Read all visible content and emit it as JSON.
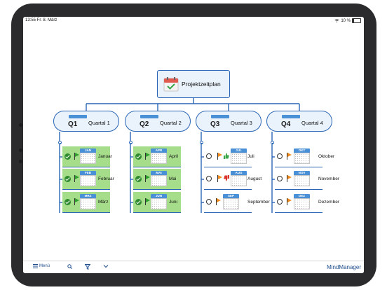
{
  "status_bar": {
    "time_date": "13:55  Fr. 8. März",
    "battery": "10 %"
  },
  "central_topic": {
    "label": "Projektzeitplan",
    "icon": "calendar-check-icon"
  },
  "colors": {
    "line": "#2a66b5",
    "accent": "#4a90d6",
    "done_fill": "#a6dd8b",
    "flag_green": "#2e9e2e",
    "flag_orange": "#f08a1c"
  },
  "quarters": [
    {
      "num": "Q1",
      "label": "Quartal 1",
      "months": [
        {
          "tab": "JAN",
          "name": "Januar",
          "status": "done",
          "flag": "green"
        },
        {
          "tab": "FEB",
          "name": "Februar",
          "status": "done",
          "flag": "green"
        },
        {
          "tab": "MRZ",
          "name": "März",
          "status": "done",
          "flag": "green"
        }
      ]
    },
    {
      "num": "Q2",
      "label": "Quartal 2",
      "months": [
        {
          "tab": "APR",
          "name": "April",
          "status": "done",
          "flag": "green"
        },
        {
          "tab": "MAI",
          "name": "Mai",
          "status": "done",
          "flag": "green"
        },
        {
          "tab": "JUN",
          "name": "Juni",
          "status": "done",
          "flag": "green"
        }
      ]
    },
    {
      "num": "Q3",
      "label": "Quartal 3",
      "months": [
        {
          "tab": "JUL",
          "name": "Juli",
          "status": "todo",
          "flag": "orange",
          "thumb": "up"
        },
        {
          "tab": "AUG",
          "name": "August",
          "status": "todo",
          "flag": "orange",
          "thumb": "down"
        },
        {
          "tab": "SEP",
          "name": "September",
          "status": "todo",
          "flag": "orange"
        }
      ]
    },
    {
      "num": "Q4",
      "label": "Quartal 4",
      "months": [
        {
          "tab": "OKT",
          "name": "Oktober",
          "status": "todo",
          "flag": "orange"
        },
        {
          "tab": "NOV",
          "name": "November",
          "status": "todo",
          "flag": "orange"
        },
        {
          "tab": "DEZ",
          "name": "Dezember",
          "status": "todo",
          "flag": "orange"
        }
      ]
    }
  ],
  "toolbar": {
    "menu_label": "Menü",
    "search_icon": "search-icon",
    "filter_icon": "filter-icon",
    "chevron_icon": "chevron-down-icon",
    "brand": "MindManager"
  }
}
